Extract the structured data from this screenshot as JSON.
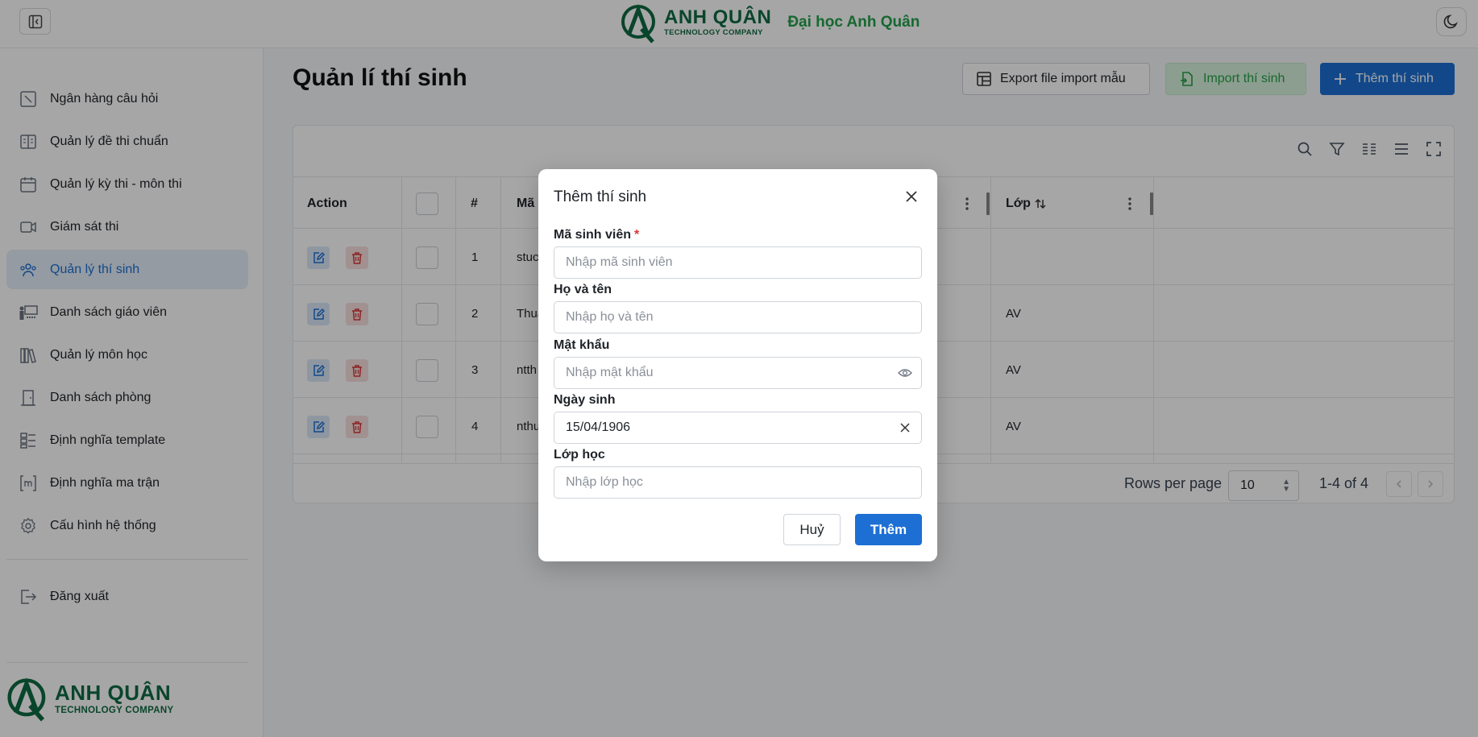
{
  "header": {
    "logo_name": "ANH QUÂN",
    "logo_sub": "TECHNOLOGY COMPANY",
    "title": "Đại học Anh Quân"
  },
  "sidebar": {
    "items": [
      {
        "label": "Ngân hàng câu hỏi",
        "icon": "question-bank-icon"
      },
      {
        "label": "Quản lý đề thi chuẩn",
        "icon": "book-icon"
      },
      {
        "label": "Quản lý kỳ thi - môn thi",
        "icon": "calendar-icon"
      },
      {
        "label": "Giám sát thi",
        "icon": "video-icon"
      },
      {
        "label": "Quản lý thí sinh",
        "icon": "users-icon"
      },
      {
        "label": "Danh sách giáo viên",
        "icon": "teacher-icon"
      },
      {
        "label": "Quản lý môn học",
        "icon": "books-icon"
      },
      {
        "label": "Danh sách phòng",
        "icon": "door-icon"
      },
      {
        "label": "Định nghĩa template",
        "icon": "template-icon"
      },
      {
        "label": "Định nghĩa ma trận",
        "icon": "matrix-icon"
      },
      {
        "label": "Cấu hình hệ thống",
        "icon": "gear-icon"
      }
    ],
    "active_index": 4,
    "logout_label": "Đăng xuất",
    "logo_name": "ANH QUÂN",
    "logo_sub": "TECHNOLOGY COMPANY"
  },
  "page": {
    "title": "Quản lí thí sinh",
    "export_label": "Export file import mẫu",
    "import_label": "Import thí sinh",
    "add_label": "Thêm thí sinh"
  },
  "table": {
    "headers": {
      "action": "Action",
      "index": "#",
      "code": "Mã",
      "class": "Lớp"
    },
    "rows": [
      {
        "index": "1",
        "code": "stuc",
        "class": ""
      },
      {
        "index": "2",
        "code": "Thua",
        "class": "AV"
      },
      {
        "index": "3",
        "code": "ntth",
        "class": "AV"
      },
      {
        "index": "4",
        "code": "nthu",
        "class": "AV"
      }
    ],
    "rows_per_page_label": "Rows per page",
    "rows_per_page": "10",
    "range": "1-4 of 4"
  },
  "modal": {
    "title": "Thêm thí sinh",
    "student_code_label": "Mã sinh viên",
    "student_code_required": "*",
    "student_code_placeholder": "Nhập mã sinh viên",
    "fullname_label": "Họ và tên",
    "fullname_placeholder": "Nhập họ và tên",
    "password_label": "Mật khẩu",
    "password_placeholder": "Nhập mật khẩu",
    "dob_label": "Ngày sinh",
    "dob_value": "15/04/1906",
    "class_label": "Lớp học",
    "class_placeholder": "Nhập lớp học",
    "cancel_label": "Huỷ",
    "submit_label": "Thêm"
  },
  "colors": {
    "primary": "#1d6fd4",
    "brand_green": "#0f6b43",
    "title_green": "#22a04a",
    "danger": "#d93737"
  }
}
